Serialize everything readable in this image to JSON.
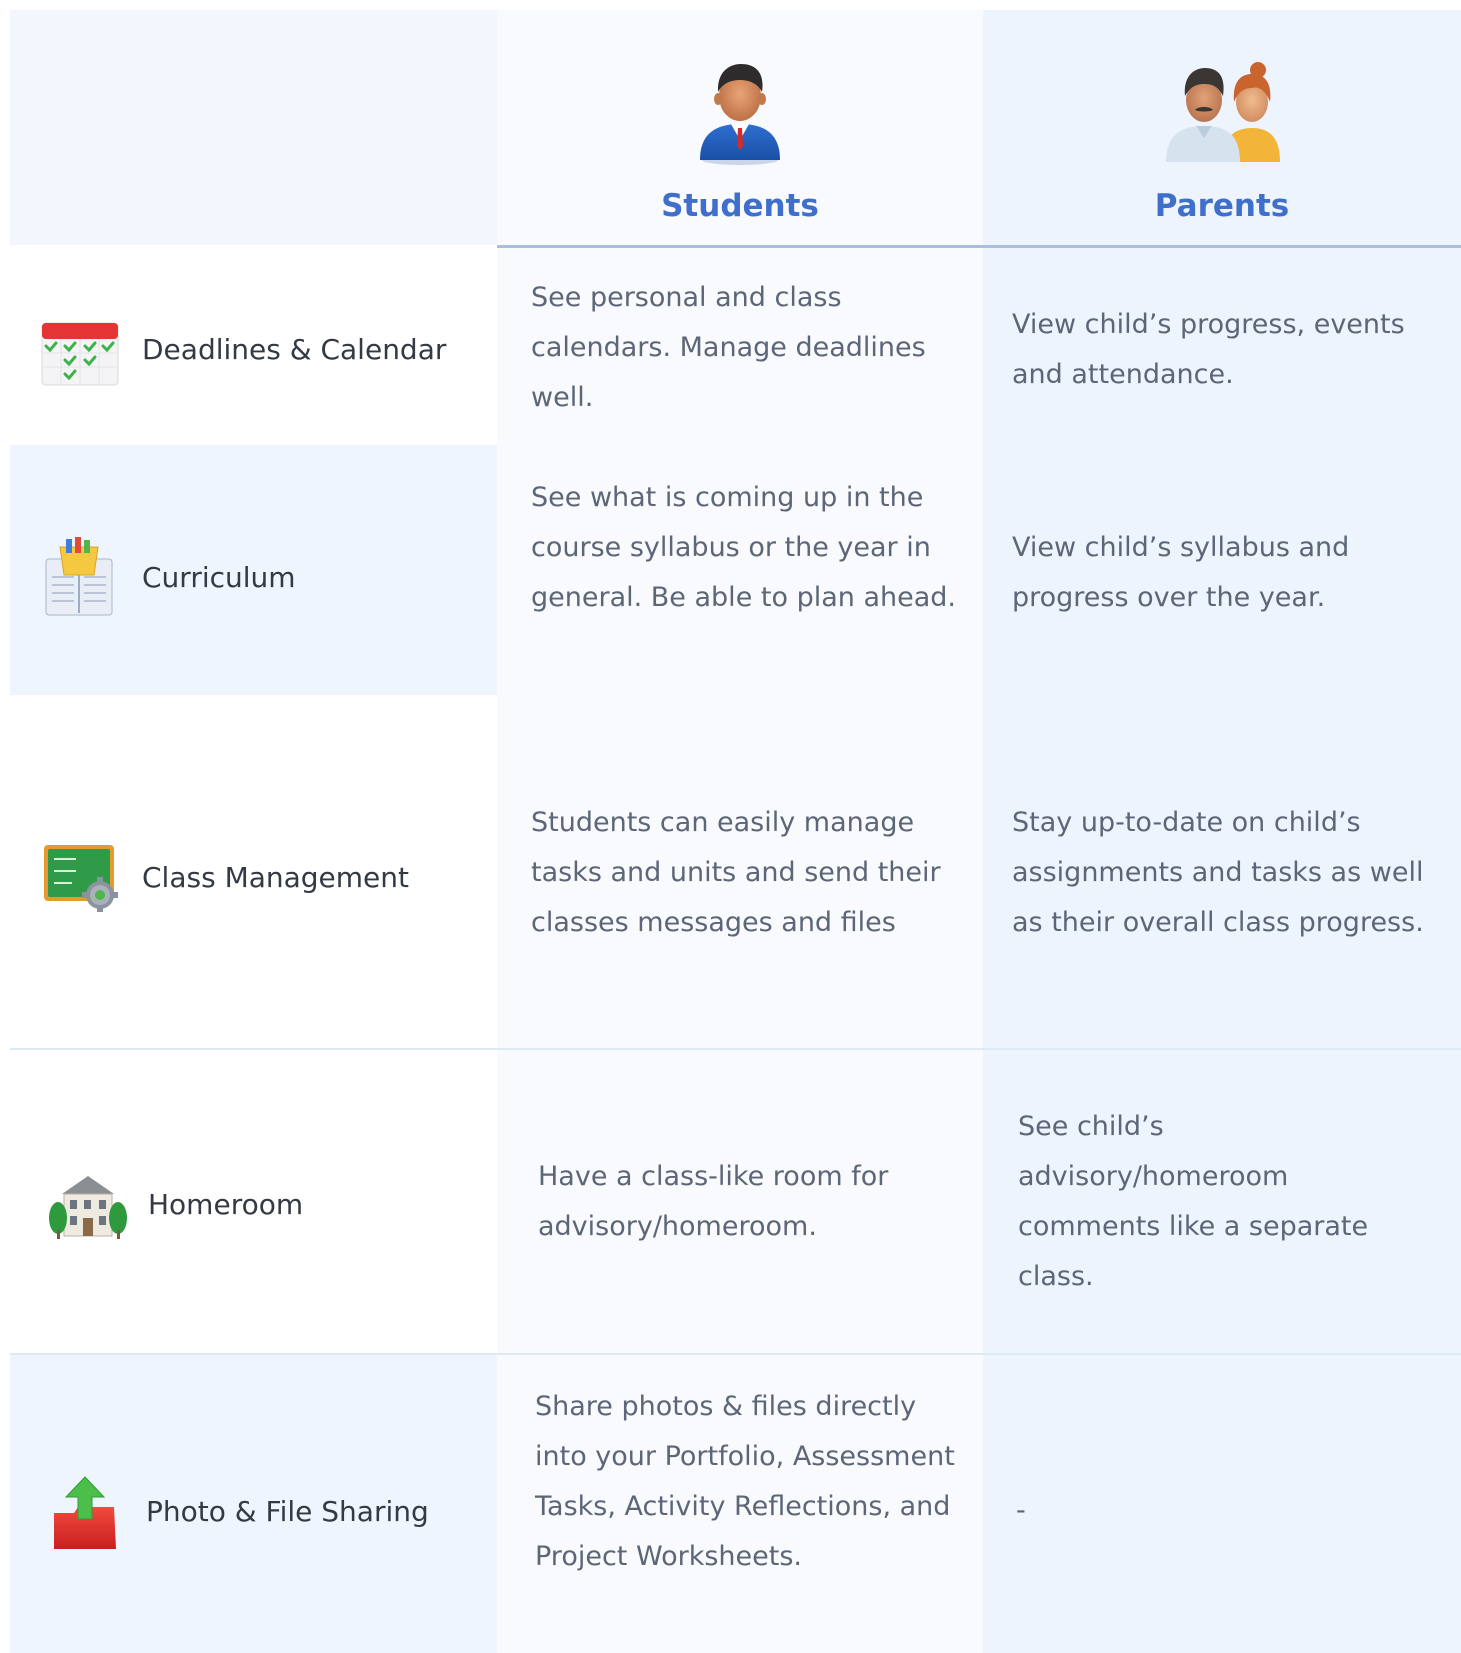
{
  "header": {
    "students": {
      "title": "Students",
      "icon": "student-icon"
    },
    "parents": {
      "title": "Parents",
      "icon": "parents-icon"
    }
  },
  "rows": [
    {
      "feature": "Deadlines & Calendar",
      "icon": "calendar-icon",
      "students": "See personal and class calendars. Manage deadlines well.",
      "parents": "View child’s progress, events and attendance."
    },
    {
      "feature": "Curriculum",
      "icon": "curriculum-icon",
      "students": "See what is coming up in the course syllabus or the year in general. Be able to plan ahead.",
      "parents": "View child’s syllabus and progress over the year."
    },
    {
      "feature": "Class Management",
      "icon": "class-management-icon",
      "students": "Students can easily manage tasks and units and send their classes messages and files",
      "parents": "Stay up-to-date on child’s assignments and tasks as well as their overall class progress."
    },
    {
      "feature": "Homeroom",
      "icon": "homeroom-icon",
      "students": "Have a class-like room for advisory/homeroom.",
      "parents": "See child’s advisory/homeroom comments like a separate class."
    },
    {
      "feature": "Photo & File Sharing",
      "icon": "upload-icon",
      "students": "Share photos & files directly into your Portfolio, Assessment Tasks, Activity Reflections, and Project Worksheets.",
      "parents": "-"
    }
  ],
  "colors": {
    "accent": "#3f6fca",
    "label_text": "#333a44",
    "desc_text": "#5c6677"
  }
}
